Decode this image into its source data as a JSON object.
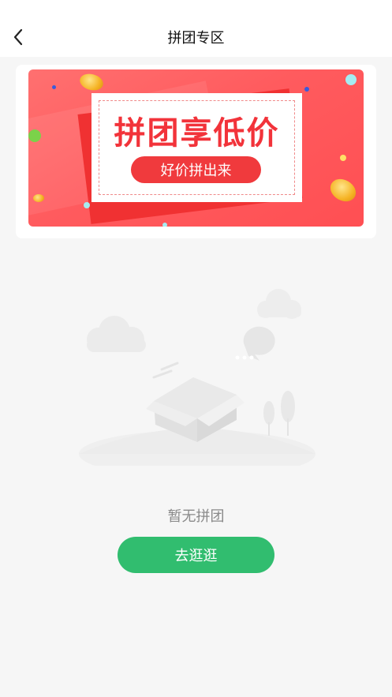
{
  "header": {
    "title": "拼团专区",
    "back_icon": "chevron-left-icon"
  },
  "banner": {
    "headline": "拼团享低价",
    "subline": "好价拼出来"
  },
  "empty_state": {
    "message": "暂无拼团",
    "action_label": "去逛逛",
    "action_color": "#31bd6f"
  }
}
